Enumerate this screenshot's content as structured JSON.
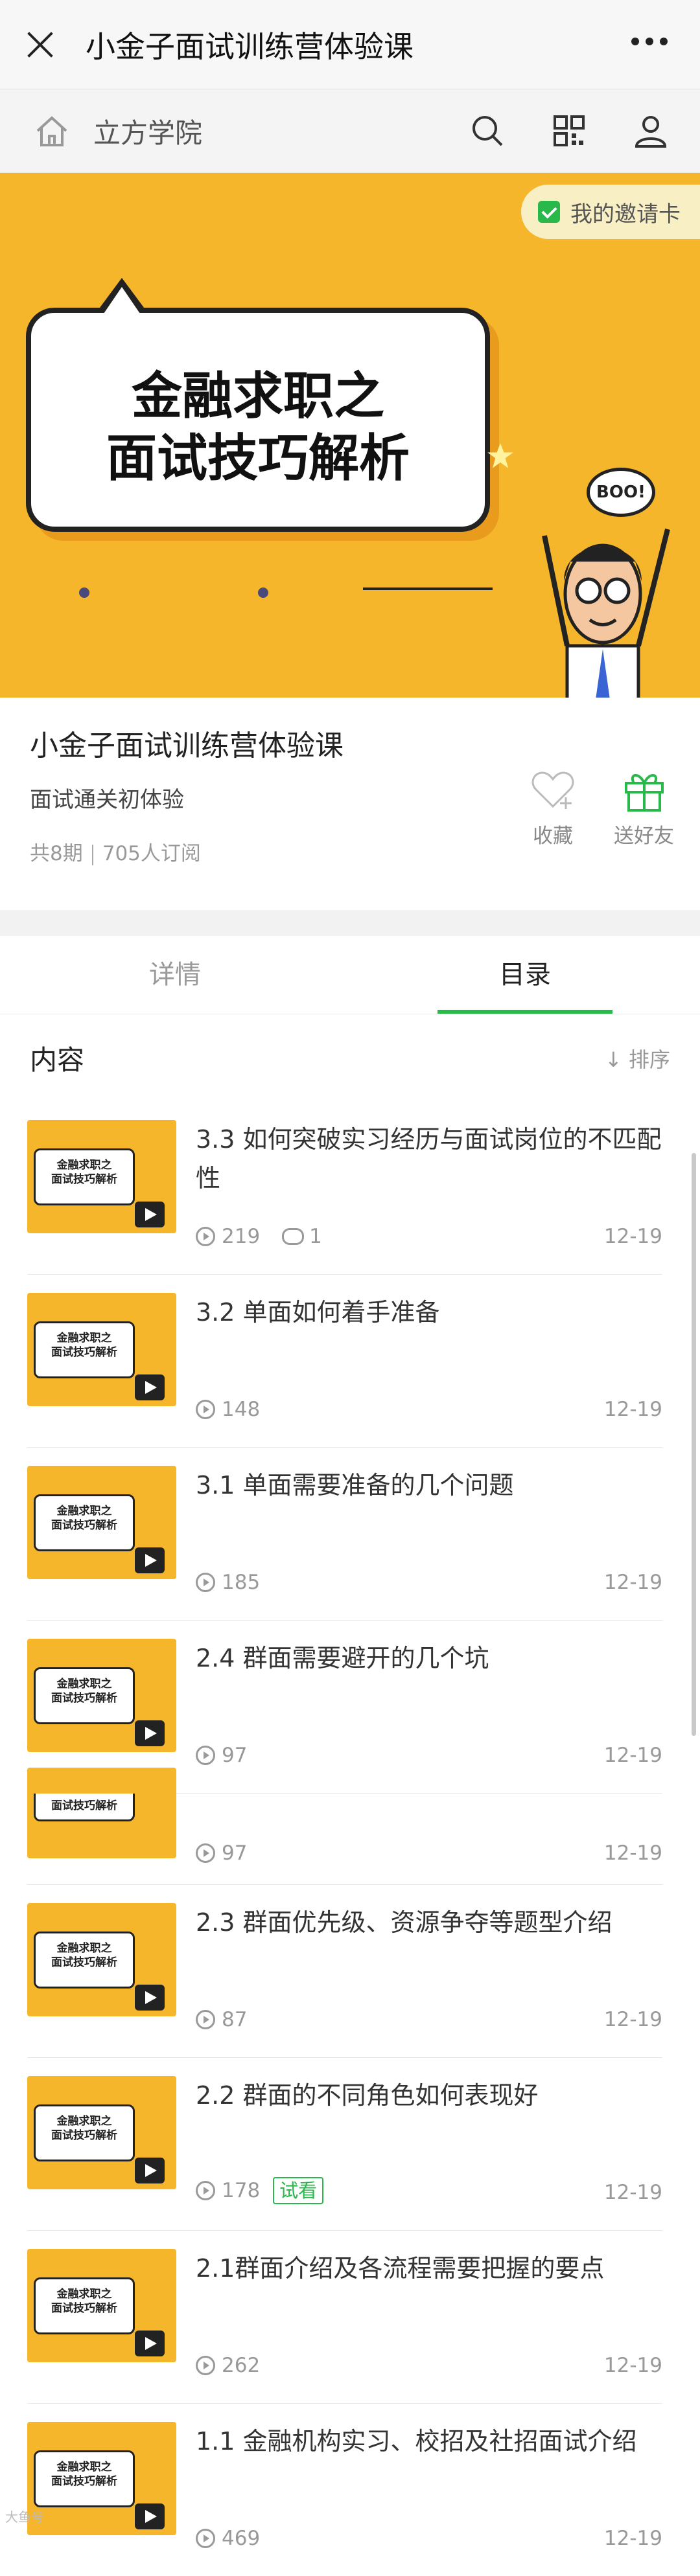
{
  "topbar": {
    "title": "小金子面试训练营体验课"
  },
  "nav": {
    "brand": "立方学院"
  },
  "banner": {
    "invite_label": "我的邀请卡",
    "headline1": "金融求职之",
    "headline2": "面试技巧解析",
    "boo": "BOO!"
  },
  "course": {
    "title": "小金子面试训练营体验课",
    "subtitle": "面试通关初体验",
    "episodes": "共8期",
    "subscribers": "705人订阅",
    "favorite_label": "收藏",
    "gift_label": "送好友"
  },
  "tabs": [
    {
      "label": "详情"
    },
    {
      "label": "目录"
    }
  ],
  "content": {
    "label": "内容",
    "sort_label": "↓ 排序",
    "items": [
      {
        "title": "3.3 如何突破实习经历与面试岗位的不匹配性",
        "views": "219",
        "comments": "1",
        "date": "12-19"
      },
      {
        "title": "3.2 单面如何着手准备",
        "views": "148",
        "date": "12-19"
      },
      {
        "title": "3.1 单面需要准备的几个问题",
        "views": "185",
        "date": "12-19"
      },
      {
        "title": "2.4 群面需要避开的几个坑",
        "views": "97",
        "date": "12-19"
      },
      {
        "title": "",
        "views": "97",
        "date": "12-19"
      },
      {
        "title": "2.3 群面优先级、资源争夺等题型介绍",
        "views": "87",
        "date": "12-19"
      },
      {
        "title": "2.2 群面的不同角色如何表现好",
        "views": "178",
        "trial": "试看",
        "date": "12-19"
      },
      {
        "title": "2.1群面介绍及各流程需要把握的要点",
        "views": "262",
        "date": "12-19"
      },
      {
        "title": "1.1 金融机构实习、校招及社招面试介绍",
        "views": "469",
        "date": "12-19"
      }
    ],
    "thumb_line1": "金融求职之",
    "thumb_line2": "面试技巧解析",
    "thumb_partial_line": "面试技巧解析"
  },
  "watermark": "大鱼号"
}
